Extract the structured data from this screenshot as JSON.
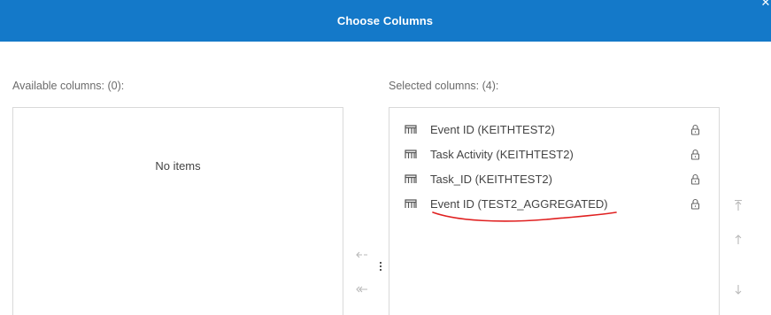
{
  "dialog": {
    "title": "Choose Columns",
    "close_icon": "close-icon"
  },
  "available": {
    "label": "Available columns: (0):",
    "empty_text": "No items",
    "items": []
  },
  "selected": {
    "label": "Selected columns: (4):",
    "items": [
      {
        "label": "Event ID (KEITHTEST2)",
        "icon": "column-icon",
        "locked": true
      },
      {
        "label": "Task Activity (KEITHTEST2)",
        "icon": "column-icon",
        "locked": true
      },
      {
        "label": "Task_ID (KEITHTEST2)",
        "icon": "column-icon",
        "locked": true
      },
      {
        "label": "Event ID (TEST2_AGGREGATED)",
        "icon": "column-icon",
        "locked": true
      }
    ]
  },
  "transfer_buttons": {
    "move_left_icon": "arrow-left-icon",
    "move_all_left_icon": "double-arrow-left-icon"
  },
  "order_buttons": {
    "move_top_icon": "move-to-top-icon",
    "move_up_icon": "arrow-up-icon",
    "move_down_icon": "arrow-down-icon"
  },
  "colors": {
    "header_bg": "#1479c9",
    "annotation": "#e02020"
  }
}
